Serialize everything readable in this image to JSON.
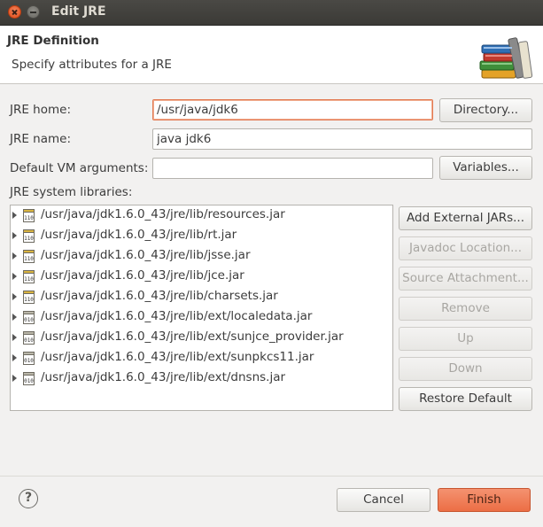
{
  "window": {
    "title": "Edit JRE"
  },
  "header": {
    "title": "JRE Definition",
    "subtitle": "Specify attributes for a JRE",
    "icon": "books-icon"
  },
  "form": {
    "jre_home_label": "JRE home:",
    "jre_home_value": "/usr/java/jdk6",
    "directory_button": "Directory...",
    "jre_name_label": "JRE name:",
    "jre_name_value": "java jdk6",
    "vm_args_label": "Default VM arguments:",
    "vm_args_value": "",
    "variables_button": "Variables...",
    "libraries_label": "JRE system libraries:"
  },
  "libraries": [
    {
      "path": "/usr/java/jdk1.6.0_43/jre/lib/resources.jar",
      "icon": "jar-library-icon"
    },
    {
      "path": "/usr/java/jdk1.6.0_43/jre/lib/rt.jar",
      "icon": "jar-library-icon"
    },
    {
      "path": "/usr/java/jdk1.6.0_43/jre/lib/jsse.jar",
      "icon": "jar-library-icon"
    },
    {
      "path": "/usr/java/jdk1.6.0_43/jre/lib/jce.jar",
      "icon": "jar-library-icon"
    },
    {
      "path": "/usr/java/jdk1.6.0_43/jre/lib/charsets.jar",
      "icon": "jar-library-icon"
    },
    {
      "path": "/usr/java/jdk1.6.0_43/jre/lib/ext/localedata.jar",
      "icon": "jar-binary-icon"
    },
    {
      "path": "/usr/java/jdk1.6.0_43/jre/lib/ext/sunjce_provider.jar",
      "icon": "jar-binary-icon"
    },
    {
      "path": "/usr/java/jdk1.6.0_43/jre/lib/ext/sunpkcs11.jar",
      "icon": "jar-binary-icon"
    },
    {
      "path": "/usr/java/jdk1.6.0_43/jre/lib/ext/dnsns.jar",
      "icon": "jar-binary-icon"
    }
  ],
  "side_buttons": {
    "add_external_jars": "Add External JARs...",
    "javadoc_location": "Javadoc Location...",
    "source_attachment": "Source Attachment...",
    "remove": "Remove",
    "up": "Up",
    "down": "Down",
    "restore_default": "Restore Default"
  },
  "footer": {
    "help": "?",
    "cancel": "Cancel",
    "finish": "Finish"
  },
  "colors": {
    "accent": "#ec6e45",
    "titlebar": "#3c3b37"
  }
}
